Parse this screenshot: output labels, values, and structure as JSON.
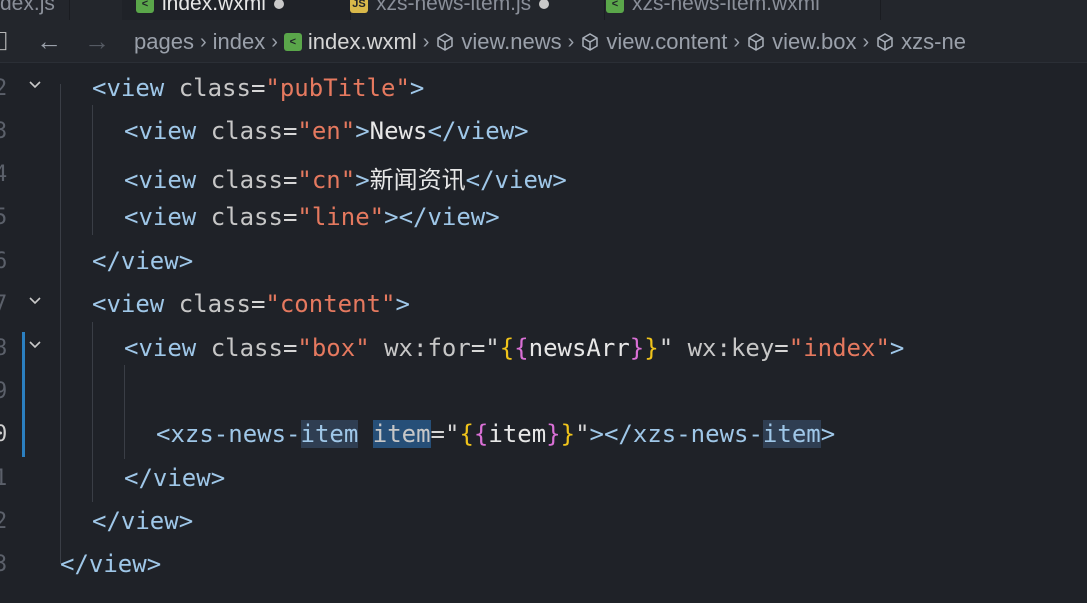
{
  "tabs": [
    {
      "label": "dex.js",
      "icon": "js-file-icon"
    },
    {
      "label": "index.wxml",
      "icon": "wxml-file-icon",
      "active": true
    },
    {
      "label": "xzs-news-item.js",
      "icon": "js-file-icon"
    },
    {
      "label": "xzs-news-item.wxml",
      "icon": "wxml-file-icon"
    }
  ],
  "breadcrumb": {
    "items": [
      "pages",
      "index",
      "index.wxml",
      "view.news",
      "view.content",
      "view.box",
      "xzs-ne"
    ]
  },
  "lines": [
    {
      "num": "2",
      "tokens": {
        "open": "<",
        "tag": "view",
        "sp": " ",
        "attr": "class",
        "eq": "=",
        "val": "\"pubTitle\"",
        "close": ">"
      }
    },
    {
      "num": "3",
      "tokens": {
        "open": "<",
        "tag": "view",
        "attr": "class",
        "eq": "=",
        "val": "\"en\"",
        "close": ">",
        "text": "News",
        "end": "</view>"
      }
    },
    {
      "num": "4",
      "tokens": {
        "open": "<",
        "tag": "view",
        "attr": "class",
        "eq": "=",
        "val": "\"cn\"",
        "close": ">",
        "text": "新闻资讯",
        "end": "</view>"
      }
    },
    {
      "num": "5",
      "tokens": {
        "open": "<",
        "tag": "view",
        "attr": "class",
        "eq": "=",
        "val": "\"line\"",
        "close": ">",
        "end": "</view>"
      }
    },
    {
      "num": "6",
      "tokens": {
        "end": "</view>"
      }
    },
    {
      "num": "7",
      "tokens": {
        "open": "<",
        "tag": "view",
        "attr": "class",
        "eq": "=",
        "val": "\"content\"",
        "close": ">"
      }
    },
    {
      "num": "8",
      "tokens": {
        "open": "<",
        "tag": "view",
        "attr": "class",
        "eq": "=",
        "val": "\"box\"",
        "attr2": "wx:for",
        "val2": "newsArr",
        "attr3": "wx:key",
        "val3": "\"index\"",
        "close": ">"
      }
    },
    {
      "num": "9",
      "tokens": {}
    },
    {
      "num": "0",
      "tokens": {
        "open": "<",
        "tagA": "xzs-news-",
        "tagB": "item",
        "attr": "item",
        "val": "item",
        "endA": "</xzs-news-",
        "endB": "item",
        "close": ">"
      }
    },
    {
      "num": "1",
      "tokens": {
        "end": "</view>"
      }
    },
    {
      "num": "2",
      "tokens": {
        "end": "</view>"
      }
    },
    {
      "num": "3",
      "tokens": {
        "end": "</view>"
      }
    }
  ]
}
